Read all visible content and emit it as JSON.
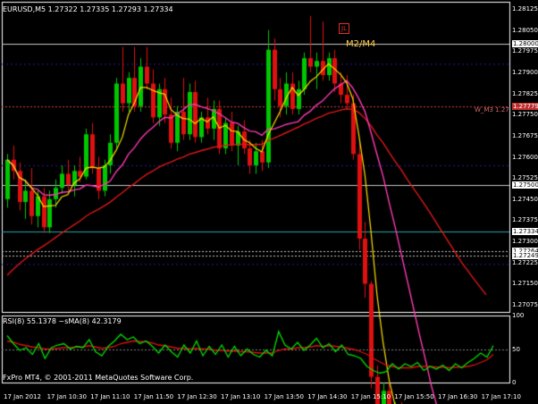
{
  "header": {
    "symbol": "EURUSD,M5",
    "ohlc": "1.27322 1.27335 1.27293 1.27334",
    "mark_label": "M2/M4",
    "flag_label": "JL",
    "object_label": "W_M3 1.27"
  },
  "colors": {
    "background": "#000000",
    "bull": "#00c800",
    "bear": "#e01010",
    "ma_fast": "#ffe000",
    "ma_mid": "#ff3ab4",
    "ma_slow": "#e01818",
    "rsi": "#00e000",
    "rsi_ma": "#e01010",
    "grid": "#2020a0"
  },
  "price_axis": {
    "ticks": [
      "1.28125",
      "1.28050",
      "1.27975",
      "1.27900",
      "1.27825",
      "1.27750",
      "1.27675",
      "1.27600",
      "1.27525",
      "1.27450",
      "1.27375",
      "1.27300",
      "1.27225",
      "1.27150",
      "1.27075"
    ],
    "boxes": [
      "1.28000",
      "1.27779",
      "1.27500",
      "1.27334",
      "1.27264",
      "1.27249"
    ]
  },
  "time_axis": {
    "labels": [
      "17 Jan 2012",
      "17 Jan 10:30",
      "17 Jan 11:10",
      "17 Jan 11:50",
      "17 Jan 12:30",
      "17 Jan 13:10",
      "17 Jan 13:50",
      "17 Jan 14:30",
      "17 Jan 15:10",
      "17 Jan 15:50",
      "17 Jan 16:30",
      "17 Jan 17:10"
    ]
  },
  "indicator": {
    "label": "RSI(8) 55.1378  ~sMA(8) 42.3179",
    "levels": [
      "100",
      "50",
      "0"
    ]
  },
  "footer": {
    "copyright": "FxPro MT4, © 2001-2011 MetaQuotes Software Corp."
  },
  "chart_data": {
    "type": "candlestick",
    "symbol": "EURUSD",
    "timeframe": "M5",
    "ylim": [
      1.2705,
      1.2815
    ],
    "hlines": [
      1.28,
      1.27779,
      1.275,
      1.27334,
      1.27264,
      1.27249
    ],
    "candles": [
      [
        1.2745,
        1.2761,
        1.2742,
        1.2759
      ],
      [
        1.2759,
        1.2764,
        1.2752,
        1.2755
      ],
      [
        1.2755,
        1.2758,
        1.2741,
        1.2744
      ],
      [
        1.2744,
        1.2752,
        1.2738,
        1.2748
      ],
      [
        1.2748,
        1.2756,
        1.2736,
        1.2739
      ],
      [
        1.2739,
        1.2748,
        1.2735,
        1.2746
      ],
      [
        1.2746,
        1.2749,
        1.2733,
        1.2735
      ],
      [
        1.2735,
        1.2748,
        1.2733,
        1.2745
      ],
      [
        1.2745,
        1.2752,
        1.2742,
        1.2749
      ],
      [
        1.2749,
        1.2757,
        1.2747,
        1.2754
      ],
      [
        1.2754,
        1.2759,
        1.2748,
        1.275
      ],
      [
        1.275,
        1.2757,
        1.2746,
        1.2755
      ],
      [
        1.2755,
        1.276,
        1.2751,
        1.2753
      ],
      [
        1.2753,
        1.277,
        1.2752,
        1.2768
      ],
      [
        1.2768,
        1.2772,
        1.2754,
        1.2756
      ],
      [
        1.2756,
        1.276,
        1.2745,
        1.2748
      ],
      [
        1.2748,
        1.2759,
        1.2746,
        1.2757
      ],
      [
        1.2757,
        1.2768,
        1.2754,
        1.2765
      ],
      [
        1.2765,
        1.2788,
        1.2763,
        1.2786
      ],
      [
        1.2786,
        1.2799,
        1.2776,
        1.2779
      ],
      [
        1.2779,
        1.279,
        1.2776,
        1.2788
      ],
      [
        1.2788,
        1.2799,
        1.2776,
        1.2778
      ],
      [
        1.2778,
        1.2795,
        1.2776,
        1.2792
      ],
      [
        1.2792,
        1.2799,
        1.2784,
        1.2786
      ],
      [
        1.2786,
        1.2791,
        1.2772,
        1.2774
      ],
      [
        1.2774,
        1.2786,
        1.2771,
        1.2784
      ],
      [
        1.2784,
        1.2788,
        1.2772,
        1.2775
      ],
      [
        1.2775,
        1.2781,
        1.2763,
        1.2765
      ],
      [
        1.2765,
        1.2778,
        1.2762,
        1.2776
      ],
      [
        1.2776,
        1.2788,
        1.2766,
        1.2768
      ],
      [
        1.2768,
        1.2786,
        1.2766,
        1.2783
      ],
      [
        1.2783,
        1.2787,
        1.2765,
        1.2767
      ],
      [
        1.2767,
        1.2776,
        1.2765,
        1.2774
      ],
      [
        1.2774,
        1.2781,
        1.2768,
        1.277
      ],
      [
        1.277,
        1.278,
        1.2766,
        1.2777
      ],
      [
        1.2777,
        1.278,
        1.2761,
        1.2763
      ],
      [
        1.2763,
        1.2774,
        1.2761,
        1.2772
      ],
      [
        1.2772,
        1.2776,
        1.2762,
        1.2764
      ],
      [
        1.2764,
        1.2771,
        1.2757,
        1.2769
      ],
      [
        1.2769,
        1.2773,
        1.2761,
        1.2763
      ],
      [
        1.2763,
        1.2766,
        1.2754,
        1.2757
      ],
      [
        1.2757,
        1.2765,
        1.2754,
        1.2762
      ],
      [
        1.2762,
        1.2766,
        1.2755,
        1.2758
      ],
      [
        1.2758,
        1.2805,
        1.2756,
        1.2798
      ],
      [
        1.2798,
        1.2802,
        1.278,
        1.2784
      ],
      [
        1.2784,
        1.2788,
        1.2774,
        1.2778
      ],
      [
        1.2778,
        1.279,
        1.2775,
        1.2786
      ],
      [
        1.2786,
        1.279,
        1.2775,
        1.2777
      ],
      [
        1.2777,
        1.2787,
        1.2775,
        1.2784
      ],
      [
        1.2784,
        1.2797,
        1.2782,
        1.2795
      ],
      [
        1.2795,
        1.281,
        1.279,
        1.2792
      ],
      [
        1.2792,
        1.2797,
        1.2784,
        1.2794
      ],
      [
        1.2794,
        1.2808,
        1.2787,
        1.2789
      ],
      [
        1.2789,
        1.2797,
        1.2787,
        1.2795
      ],
      [
        1.2795,
        1.2798,
        1.2783,
        1.2786
      ],
      [
        1.2786,
        1.279,
        1.2779,
        1.2782
      ],
      [
        1.2782,
        1.2789,
        1.2777,
        1.2779
      ],
      [
        1.2779,
        1.2782,
        1.2759,
        1.2761
      ],
      [
        1.2761,
        1.2766,
        1.2727,
        1.2731
      ],
      [
        1.2731,
        1.2737,
        1.271,
        1.2715
      ],
      [
        1.2715,
        1.2716,
        1.2678,
        1.2682
      ],
      [
        1.2682,
        1.2686,
        1.2663,
        1.2666
      ],
      [
        1.2666,
        1.268,
        1.2662,
        1.2677
      ],
      [
        1.2677,
        1.268,
        1.266,
        1.2664
      ],
      [
        1.2664,
        1.2673,
        1.266,
        1.2669
      ],
      [
        1.2669,
        1.2673,
        1.2658,
        1.2661
      ],
      [
        1.2661,
        1.2667,
        1.2654,
        1.2657
      ],
      [
        1.2657,
        1.2664,
        1.265,
        1.2661
      ],
      [
        1.2661,
        1.2666,
        1.265,
        1.2652
      ],
      [
        1.2652,
        1.266,
        1.2647,
        1.2656
      ],
      [
        1.2656,
        1.266,
        1.2644,
        1.2647
      ],
      [
        1.2647,
        1.2655,
        1.2644,
        1.2652
      ],
      [
        1.2652,
        1.2657,
        1.264,
        1.2643
      ],
      [
        1.2643,
        1.2651,
        1.264,
        1.2649
      ],
      [
        1.2649,
        1.2653,
        1.2641,
        1.2644
      ],
      [
        1.2644,
        1.2653,
        1.2641,
        1.265
      ],
      [
        1.265,
        1.266,
        1.2647,
        1.2658
      ],
      [
        1.2658,
        1.2668,
        1.2655,
        1.2665
      ],
      [
        1.2665,
        1.2667,
        1.2659,
        1.2662
      ],
      [
        1.2662,
        1.267,
        1.266,
        1.2668
      ]
    ],
    "rsi": [
      70,
      58,
      48,
      52,
      42,
      58,
      36,
      52,
      56,
      58,
      50,
      54,
      52,
      64,
      46,
      40,
      54,
      62,
      72,
      64,
      68,
      58,
      62,
      54,
      44,
      56,
      46,
      38,
      56,
      44,
      62,
      40,
      54,
      42,
      56,
      38,
      54,
      40,
      50,
      42,
      38,
      48,
      40,
      76,
      56,
      50,
      60,
      48,
      56,
      66,
      52,
      58,
      46,
      56,
      42,
      40,
      36,
      24,
      18,
      14,
      16,
      28,
      20,
      28,
      24,
      30,
      18,
      24,
      20,
      26,
      18,
      28,
      22,
      30,
      36,
      44,
      38,
      55
    ],
    "rsi_ma": [
      62,
      60,
      57,
      55,
      53,
      52,
      50,
      50,
      51,
      52,
      52,
      53,
      53,
      55,
      53,
      51,
      52,
      54,
      58,
      60,
      62,
      61,
      61,
      59,
      56,
      55,
      53,
      51,
      51,
      50,
      51,
      50,
      50,
      48,
      48,
      47,
      47,
      46,
      46,
      45,
      44,
      44,
      44,
      48,
      50,
      50,
      52,
      52,
      53,
      55,
      54,
      55,
      54,
      53,
      51,
      49,
      46,
      42,
      36,
      31,
      26,
      24,
      22,
      22,
      22,
      24,
      24,
      24,
      23,
      23,
      22,
      23,
      23,
      24,
      26,
      30,
      34,
      42
    ]
  }
}
